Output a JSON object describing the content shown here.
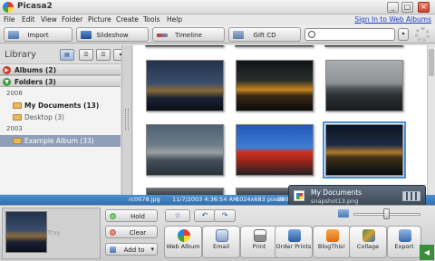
{
  "window": {
    "title": "Picasa2",
    "minimize": "_",
    "maximize": "□",
    "close": "×"
  },
  "menu": {
    "items": [
      "File",
      "Edit",
      "View",
      "Folder",
      "Picture",
      "Create",
      "Tools",
      "Help"
    ],
    "signin": "Sign In to Web Albums"
  },
  "toolbar": {
    "import": "Import",
    "slideshow": "Slideshow",
    "timeline": "Timeline",
    "giftcd": "Gift CD",
    "search_value": "",
    "search_dropdown": "▾"
  },
  "library": {
    "title": "Library",
    "albums": "Albums (2)",
    "folders": "Folders (3)",
    "year_2008": "2008",
    "my_documents": "My Documents (13)",
    "desktop": "Desktop (3)",
    "year_2003": "2003",
    "example_album": "Example Album (33)",
    "toggle_collapsed": "▶",
    "toggle_expanded": "▼",
    "view_buttons": [
      "▤",
      "☰",
      "▾"
    ]
  },
  "status": {
    "file": "rc0078.jpg",
    "date": "11/7/2003 4:36:54 AM",
    "size": "1024x683 pixels",
    "extra": "180"
  },
  "popup": {
    "title": "My Documents",
    "file": "snapshot13.png"
  },
  "tray": {
    "label": "Tray",
    "hold": "Hold",
    "clear": "Clear",
    "add_to": "Add to",
    "add_to_arrow": "▾",
    "star": "☆",
    "rotate_left": "↶",
    "rotate_right": "↷",
    "actions": [
      "Web Album",
      "Email",
      "Print",
      "Order Prints",
      "BlogThis!",
      "Collage",
      "Export"
    ],
    "expand": "◀"
  },
  "colors": {
    "accent": "#2f6fb2",
    "selection": "#8f9fb8",
    "albums_toggle": "#d03a2a",
    "folders_toggle": "#3f9b3f"
  }
}
